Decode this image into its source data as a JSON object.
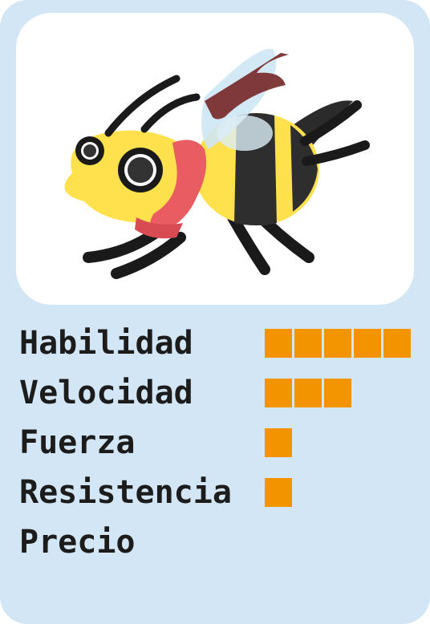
{
  "card": {
    "colors": {
      "background": "#d3e6f5",
      "art_panel": "#ffffff",
      "pip": "#f29400",
      "text": "#1c1c1c"
    },
    "art": {
      "icon": "bee-with-red-scarf-icon"
    },
    "stats": [
      {
        "label": "Habilidad",
        "value": 5
      },
      {
        "label": "Velocidad",
        "value": 3
      },
      {
        "label": "Fuerza",
        "value": 1
      },
      {
        "label": "Resistencia",
        "value": 1
      },
      {
        "label": "Precio",
        "value": 0
      }
    ]
  }
}
